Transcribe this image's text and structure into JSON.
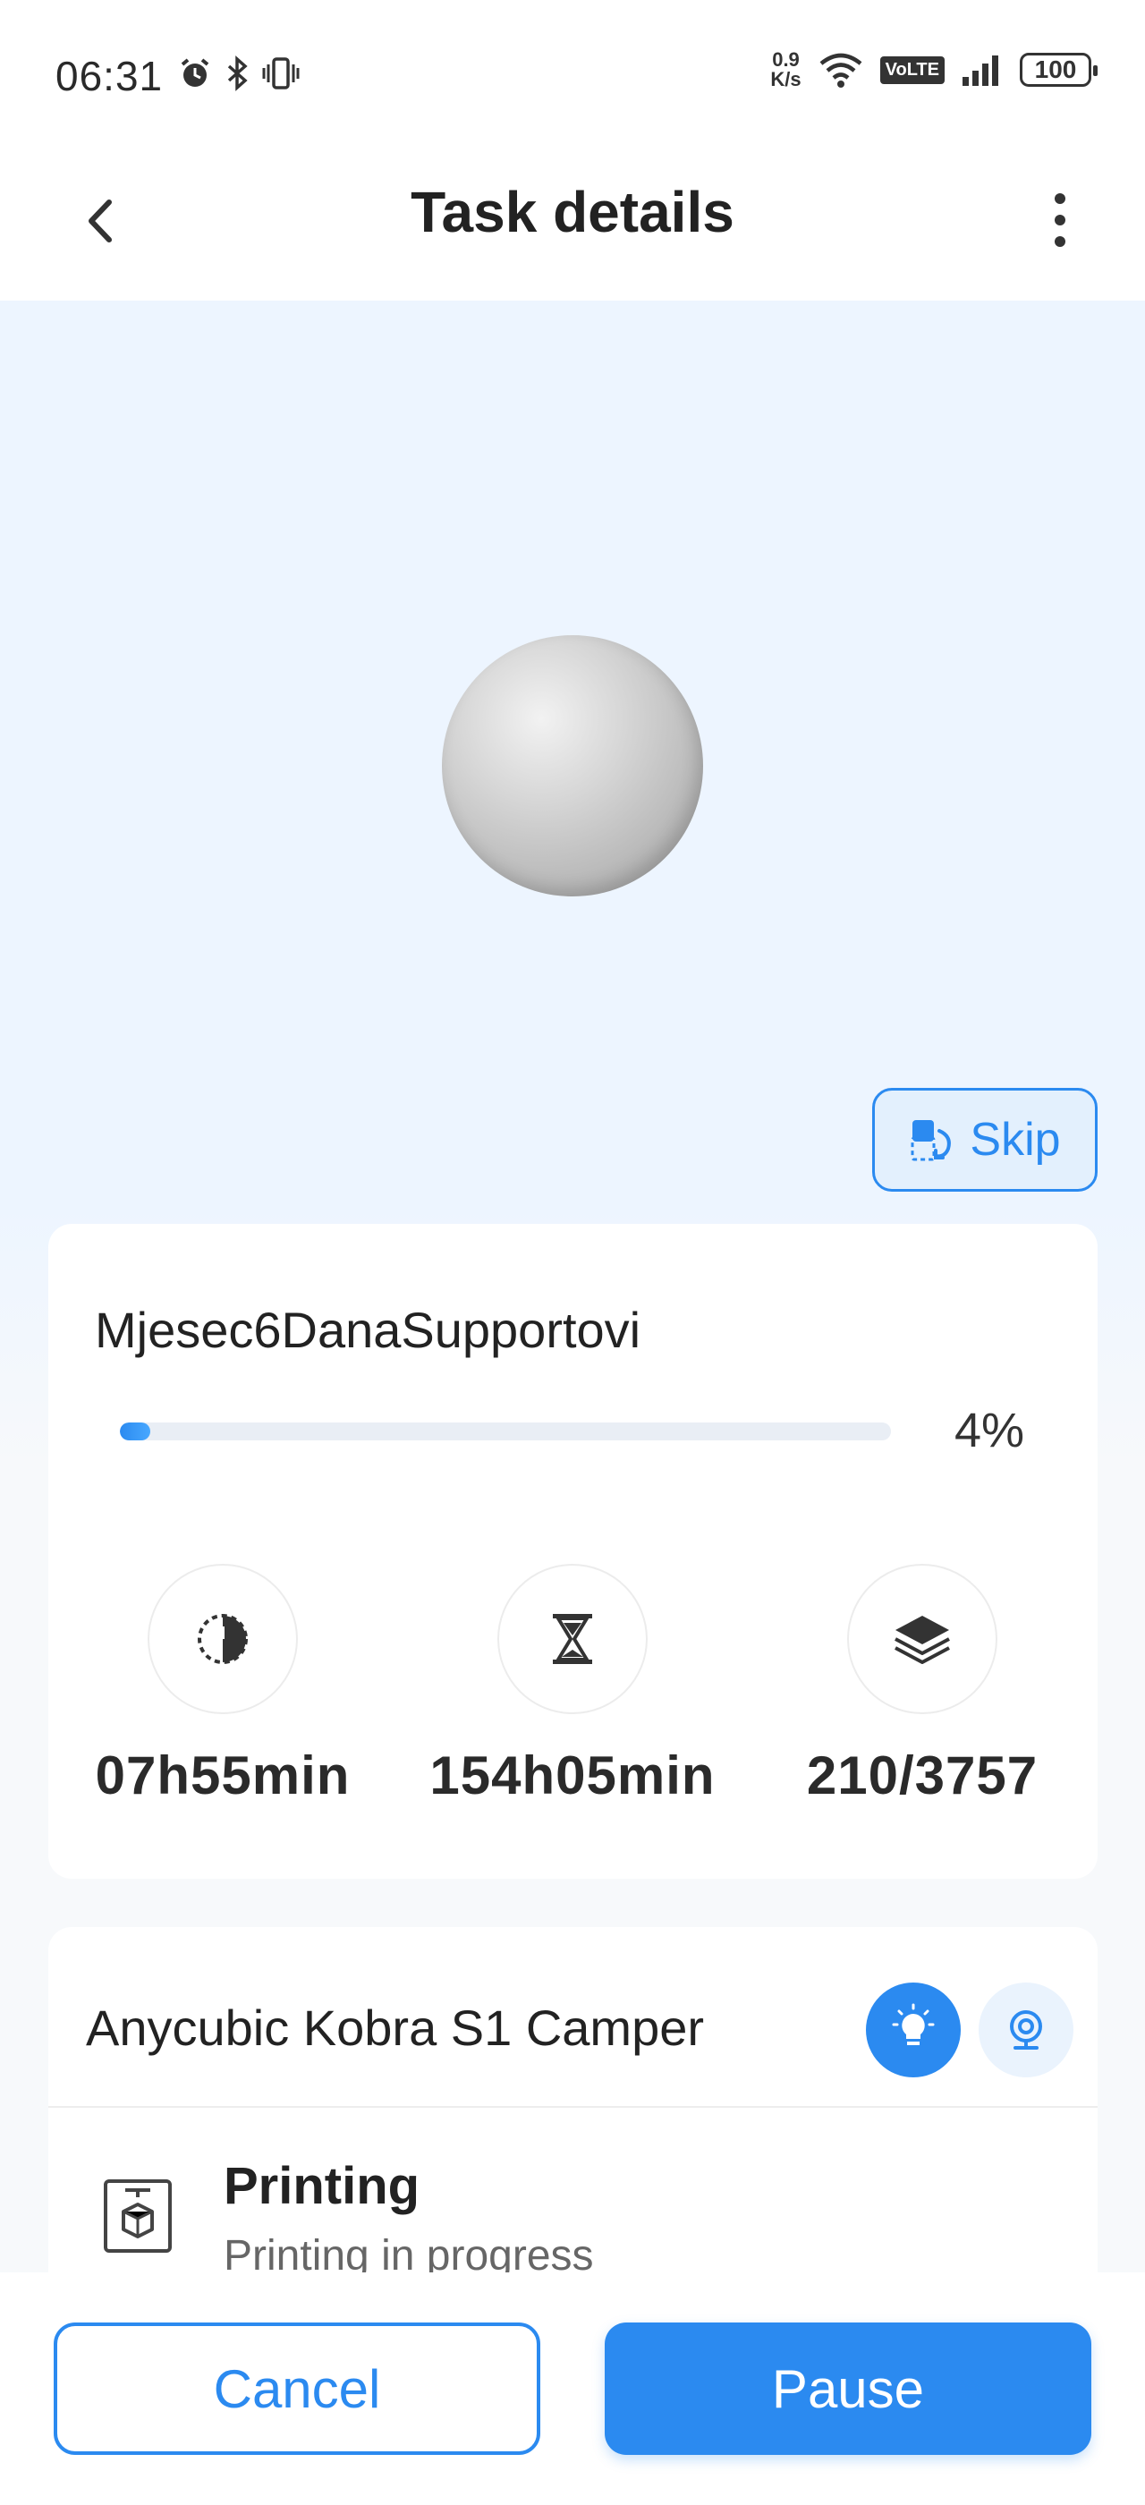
{
  "status_bar": {
    "time": "06:31",
    "net_speed_value": "0.9",
    "net_speed_unit": "K/s",
    "volte": "VoLTE",
    "battery": "100"
  },
  "header": {
    "title": "Task details",
    "back_icon": "chevron-left-icon",
    "menu_icon": "more-vertical-icon"
  },
  "hero": {
    "skip_label": "Skip",
    "skip_icon": "skip-object-icon"
  },
  "task": {
    "file_name": "Mjesec6DanaSupportovi",
    "progress_percent": 4,
    "progress_label": "4%",
    "stats": [
      {
        "icon": "elapsed-time-icon",
        "value": "07h55min"
      },
      {
        "icon": "hourglass-icon",
        "value": "154h05min"
      },
      {
        "icon": "layers-icon",
        "value": "210/3757"
      }
    ]
  },
  "printer": {
    "name": "Anycubic Kobra S1 Camper",
    "light_icon": "lightbulb-icon",
    "camera_icon": "camera-icon",
    "status_icon": "printer-icon",
    "status_title": "Printing",
    "status_subtitle": "Printing in progress"
  },
  "actions": {
    "cancel_label": "Cancel",
    "pause_label": "Pause"
  },
  "colors": {
    "accent": "#2b8af0",
    "hero_bg": "#edf5ff"
  }
}
